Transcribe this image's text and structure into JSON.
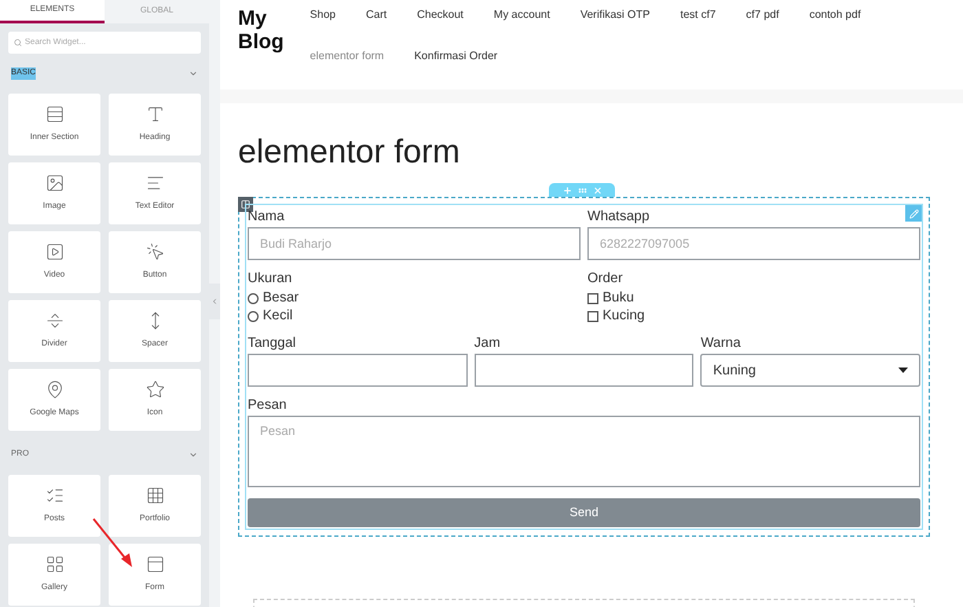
{
  "sidebar": {
    "tabs": [
      {
        "label": "ELEMENTS",
        "selected": true
      },
      {
        "label": "GLOBAL",
        "selected": false
      }
    ],
    "search": {
      "placeholder": "Search Widget..."
    },
    "sections": [
      {
        "title": "BASIC",
        "highlighted": true,
        "widgets": [
          {
            "label": "Inner Section"
          },
          {
            "label": "Heading"
          },
          {
            "label": "Image"
          },
          {
            "label": "Text Editor"
          },
          {
            "label": "Video"
          },
          {
            "label": "Button"
          },
          {
            "label": "Divider"
          },
          {
            "label": "Spacer"
          },
          {
            "label": "Google Maps"
          },
          {
            "label": "Icon"
          }
        ]
      },
      {
        "title": "PRO",
        "highlighted": false,
        "widgets": [
          {
            "label": "Posts"
          },
          {
            "label": "Portfolio"
          },
          {
            "label": "Gallery"
          },
          {
            "label": "Form"
          }
        ]
      }
    ]
  },
  "header": {
    "site_title": "My Blog",
    "nav": [
      {
        "label": "Shop",
        "selected": false
      },
      {
        "label": "Cart",
        "selected": false
      },
      {
        "label": "Checkout",
        "selected": false
      },
      {
        "label": "My account",
        "selected": false
      },
      {
        "label": "Verifikasi OTP",
        "selected": false
      },
      {
        "label": "test cf7",
        "selected": false
      },
      {
        "label": "cf7 pdf",
        "selected": false
      },
      {
        "label": "contoh pdf",
        "selected": false
      },
      {
        "label": "elementor form",
        "selected": true
      },
      {
        "label": "Konfirmasi Order",
        "selected": false
      }
    ]
  },
  "page_title": "elementor form",
  "form": {
    "rows": [
      [
        {
          "kind": "text",
          "label": "Nama",
          "placeholder": "Budi Raharjo"
        },
        {
          "kind": "text",
          "label": "Whatsapp",
          "placeholder": "6282227097005"
        }
      ],
      [
        {
          "kind": "radio",
          "label": "Ukuran",
          "options": [
            {
              "label": "Besar",
              "checked": false
            },
            {
              "label": "Kecil",
              "checked": false
            }
          ]
        },
        {
          "kind": "checkbox",
          "label": "Order",
          "options": [
            {
              "label": "Buku",
              "checked": false
            },
            {
              "label": "Kucing",
              "checked": false
            }
          ]
        }
      ],
      [
        {
          "kind": "text",
          "label": "Tanggal"
        },
        {
          "kind": "text",
          "label": "Jam"
        },
        {
          "kind": "select",
          "label": "Warna",
          "value": "Kuning"
        }
      ],
      [
        {
          "kind": "textarea",
          "label": "Pesan",
          "placeholder": "Pesan"
        }
      ]
    ],
    "submit": "Send"
  }
}
